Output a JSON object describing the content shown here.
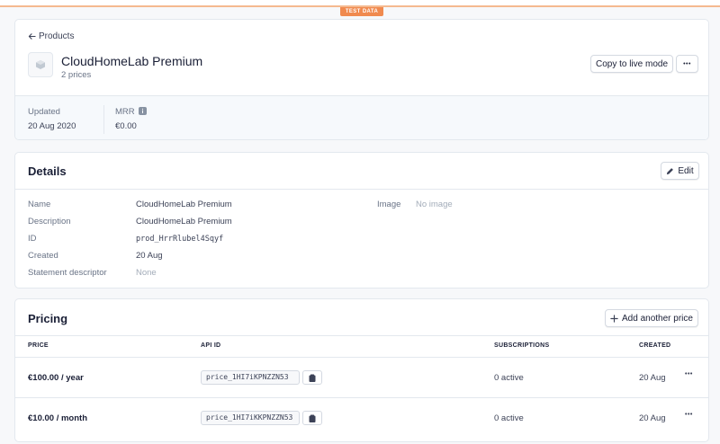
{
  "banner": {
    "test_label": "TEST DATA"
  },
  "header": {
    "back_label": "Products",
    "title": "CloudHomeLab Premium",
    "subtitle": "2 prices",
    "copy_live_label": "Copy to live mode",
    "more_label": "•••",
    "stats": {
      "updated_label": "Updated",
      "updated_value": "20 Aug 2020",
      "mrr_label": "MRR",
      "mrr_value": "€0.00"
    }
  },
  "details": {
    "title": "Details",
    "edit_label": "Edit",
    "fields": [
      {
        "label": "Name",
        "value": "CloudHomeLab Premium"
      },
      {
        "label": "Description",
        "value": "CloudHomeLab Premium"
      },
      {
        "label": "ID",
        "value": "prod_HrrRlubel4Sqyf"
      },
      {
        "label": "Created",
        "value": "20 Aug"
      },
      {
        "label": "Statement descriptor",
        "value": "None"
      }
    ],
    "image_label": "Image",
    "image_value": "No image"
  },
  "pricing": {
    "title": "Pricing",
    "add_label": "Add another price",
    "columns": [
      "PRICE",
      "API ID",
      "SUBSCRIPTIONS",
      "CREATED"
    ],
    "rows": [
      {
        "price": "€100.00 / year",
        "api_id": "price_1HI7iKPNZZN53",
        "subscriptions": "0 active",
        "created": "20 Aug",
        "more": "•••"
      },
      {
        "price": "€10.00 / month",
        "api_id": "price_1HI7iKKPNZZN53",
        "subscriptions": "0 active",
        "created": "20 Aug",
        "more": "•••"
      }
    ]
  },
  "colors": {
    "accent_test": "#f08a4f",
    "border": "#e3e8ee",
    "text_primary": "#1a1f36",
    "text_muted": "#697386"
  }
}
